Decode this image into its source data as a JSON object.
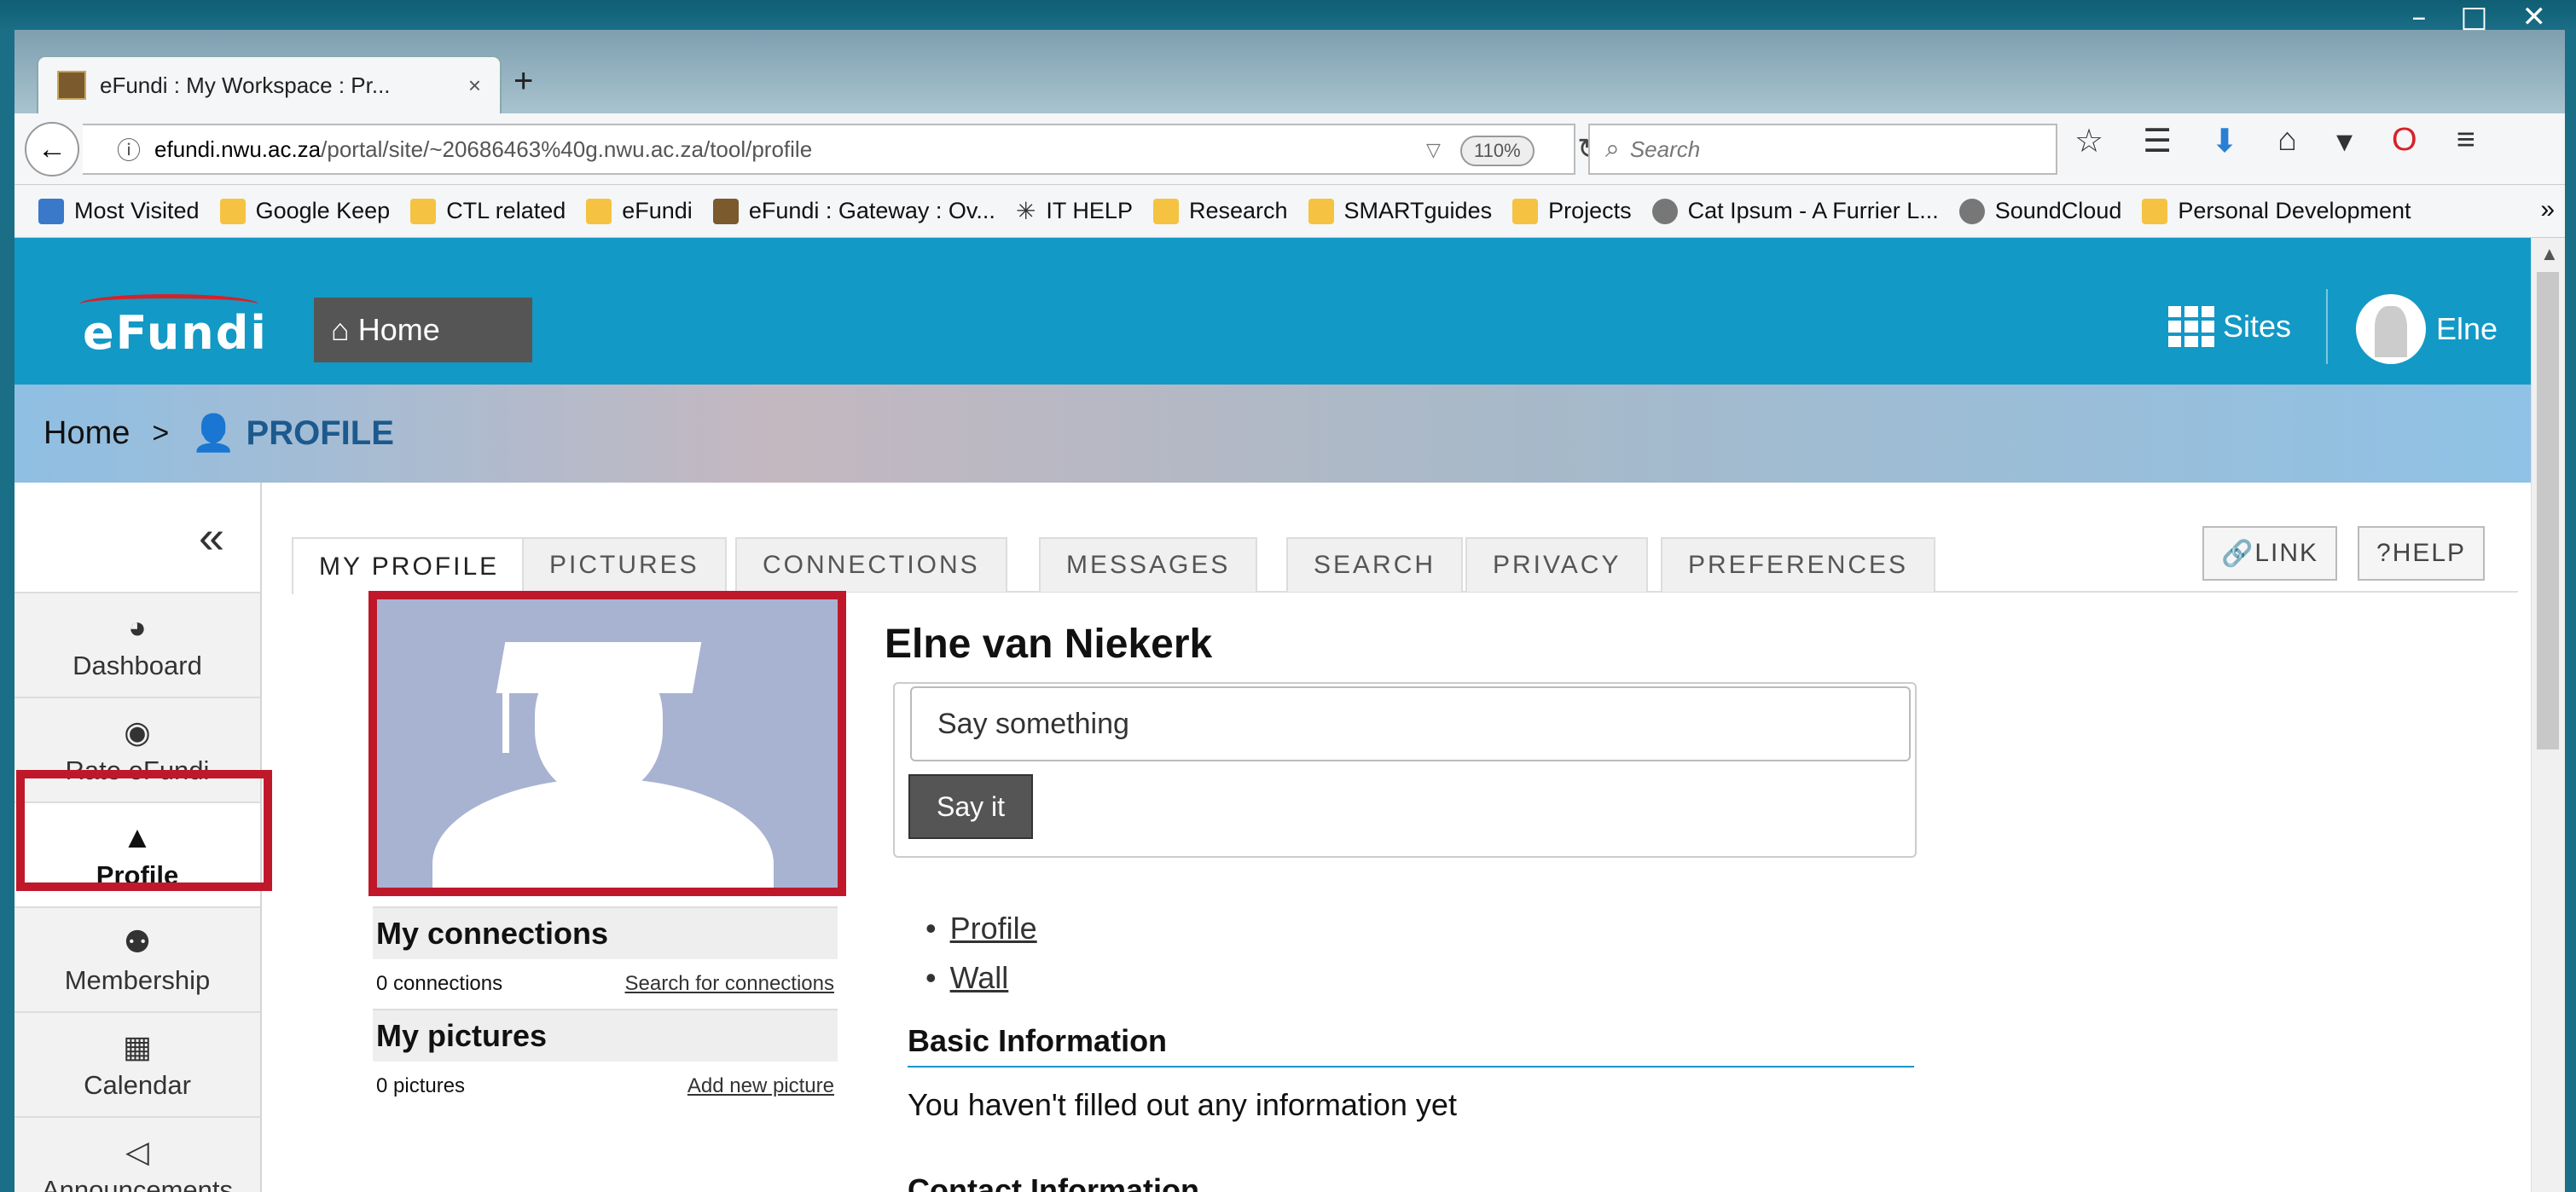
{
  "browser": {
    "tab_title": "eFundi : My Workspace : Pr...",
    "tab_close": "×",
    "new_tab": "+",
    "url_host": "efundi.nwu.ac.za",
    "url_path": "/portal/site/~20686463%40g.nwu.ac.za/tool/profile",
    "zoom": "110%",
    "search_placeholder": "Search",
    "bookmarks": [
      "Most Visited",
      "Google Keep",
      "CTL related",
      "eFundi",
      "eFundi : Gateway : Ov...",
      "IT HELP",
      "Research",
      "SMARTguides",
      "Projects",
      "Cat Ipsum - A Furrier L...",
      "SoundCloud",
      "Personal Development"
    ],
    "overflow": "»"
  },
  "header": {
    "logo": "eFundi",
    "home_label": "Home",
    "sites_label": "Sites",
    "user_name": "Elne"
  },
  "breadcrumb": {
    "home": "Home",
    "sep": ">",
    "current": "PROFILE"
  },
  "sidebar": {
    "collapse": "«",
    "items": [
      {
        "label": "Dashboard",
        "icon": "dashboard-icon"
      },
      {
        "label": "Rate eFundi",
        "icon": "globe-icon"
      },
      {
        "label": "Profile",
        "icon": "user-icon"
      },
      {
        "label": "Membership",
        "icon": "users-icon"
      },
      {
        "label": "Calendar",
        "icon": "calendar-icon"
      },
      {
        "label": "Announcements",
        "icon": "megaphone-icon"
      }
    ]
  },
  "tabs": [
    "MY PROFILE",
    "PICTURES",
    "CONNECTIONS",
    "MESSAGES",
    "SEARCH",
    "PRIVACY",
    "PREFERENCES"
  ],
  "tool_buttons": {
    "link": "LINK",
    "help": "HELP"
  },
  "profile": {
    "name": "Elne van Niekerk",
    "status_placeholder": "Say something",
    "say_button": "Say it",
    "links": [
      "Profile",
      "Wall"
    ],
    "connections_title": "My connections",
    "connections_count": "0 connections",
    "connections_link": "Search for connections",
    "pictures_title": "My pictures",
    "pictures_count": "0 pictures",
    "pictures_link": "Add new picture",
    "basic_info_title": "Basic Information",
    "basic_info_text": "You haven't filled out any information yet",
    "contact_info_title": "Contact Information"
  },
  "colors": {
    "header": "#1399c6",
    "highlight": "#c0182b",
    "brand_red": "#d62128"
  }
}
